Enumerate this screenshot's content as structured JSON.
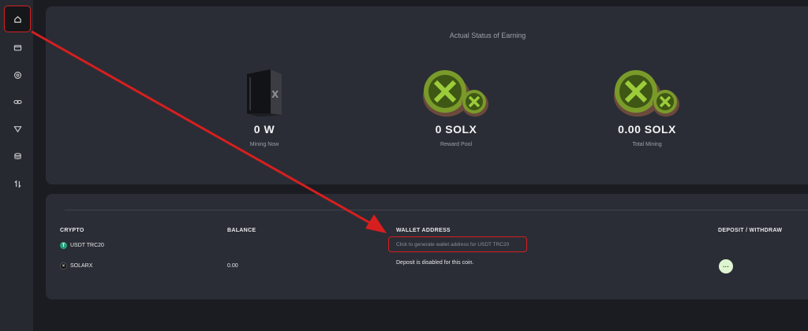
{
  "sidebar": {
    "items": [
      {
        "icon": "home-icon",
        "active": true
      },
      {
        "icon": "card-icon"
      },
      {
        "icon": "coin-icon"
      },
      {
        "icon": "link-icon"
      },
      {
        "icon": "triangle-down-icon"
      },
      {
        "icon": "database-icon"
      },
      {
        "icon": "swap-icon"
      }
    ]
  },
  "status": {
    "title": "Actual Status of Earning",
    "stats": [
      {
        "value": "0 W",
        "label": "Mining Now",
        "icon": "miner-box-icon"
      },
      {
        "value": "0 SOLX",
        "label": "Reward Pool",
        "icon": "solx-coins-icon"
      },
      {
        "value": "0.00 SOLX",
        "label": "Total Mining",
        "icon": "solx-coins-icon"
      }
    ]
  },
  "wallets": {
    "headers": {
      "crypto": "CRYPTO",
      "balance": "BALANCE",
      "address": "WALLET ADDRESS",
      "action": "DEPOSIT / WITHDRAW"
    },
    "rows": [
      {
        "crypto": "USDT TRC20",
        "balance": "",
        "address_action": "Click to generate wallet address for USDT TRC20"
      },
      {
        "crypto": "SOLARX",
        "balance": "0.00",
        "address_note": "Deposit is disabled for this coin.",
        "action_label": "···"
      }
    ]
  },
  "colors": {
    "background": "#1a1c21",
    "card": "#2a2d35",
    "highlight": "#d61f1f",
    "accent_green": "#8fb339"
  }
}
